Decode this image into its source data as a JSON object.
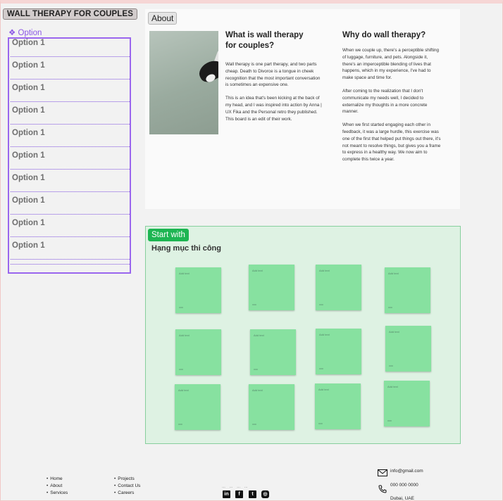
{
  "page": {
    "title": "WALL THERAPY FOR COUPLES"
  },
  "options": {
    "label": "❖ Option",
    "items": [
      "Option 1",
      "Option 1",
      "Option 1",
      "Option 1",
      "Option 1",
      "Option 1",
      "Option 1",
      "Option 1",
      "Option 1",
      "Option 1"
    ]
  },
  "about": {
    "tag": "About",
    "left_heading": "What is wall therapy for couples?",
    "left_paragraphs": [
      "Wall therapy is one part therapy, and two parts cheap. Death to Divorce is a tongue in cheek recognition that the most important conversation is sometimes an expensive one.",
      "This is an idea that's been kicking at the back of my head, and I was inspired into action by Anna | UX Fika and the Personal retro they published.  This board is an edit of their work."
    ],
    "right_heading": "Why do wall therapy?",
    "right_paragraphs": [
      "When we couple up, there's a perceptible shifting of luggage, furniture, and pets. Alongside it, there's an imperceptible blending of lives that happens, which in my experience, I've had to make space and time for.",
      "After coming to the realization that I don't communicate my needs well, I decided to externalize my thoughts in a more concrete manner.",
      "When we first started engaging each other in feedback, it was a large hurdle, this exercise was one of the first that helped put things out there, it's not meant to resolve things, but gives you a frame to express in a healthy way. We now aim to complete this twice a year."
    ]
  },
  "start": {
    "tag": "Start with",
    "section_title": "Hạng mục thi công",
    "sticky_text": "Add text",
    "sticky_foot": "ooo"
  },
  "footer": {
    "col1": [
      "Home",
      "About",
      "Services"
    ],
    "col2": [
      "Projects",
      "Contact Us",
      "Careers"
    ],
    "social": [
      "linkedin-icon",
      "facebook-icon",
      "twitter-icon",
      "instagram-icon"
    ],
    "email": "info@gmail.com",
    "phone": "000 000 0000",
    "location": "Dubai, UAE"
  },
  "colors": {
    "option_accent": "#9a66ee",
    "start_accent": "#1db552",
    "sticky": "#87e1a0",
    "start_bg": "#def2e3"
  }
}
